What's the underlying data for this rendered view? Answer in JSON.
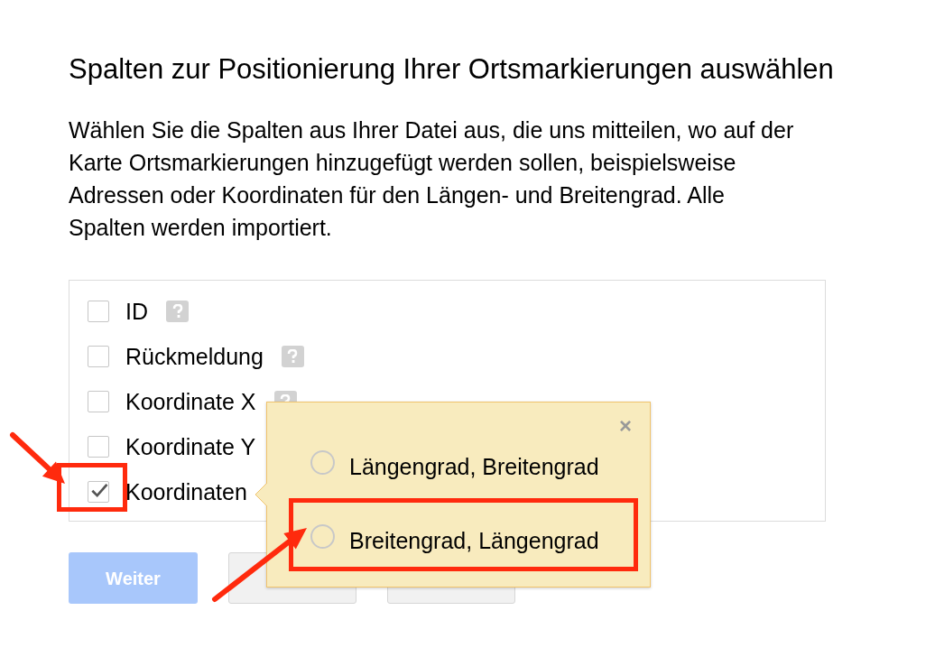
{
  "title": "Spalten zur Positionierung Ihrer Ortsmarkierungen auswählen",
  "description": "Wählen Sie die Spalten aus Ihrer Datei aus, die uns mitteilen, wo auf der Karte Ortsmarkierungen hinzugefügt werden sollen, beispielsweise Adressen oder Koordinaten für den Längen- und Breitengrad. Alle Spalten werden importiert.",
  "columns": [
    {
      "label": "ID",
      "checked": false,
      "help": true,
      "highlight": false
    },
    {
      "label": "Rückmeldung",
      "checked": false,
      "help": true,
      "highlight": false
    },
    {
      "label": "Koordinate X",
      "checked": false,
      "help": true,
      "highlight": false
    },
    {
      "label": "Koordinate Y",
      "checked": false,
      "highlight": false
    },
    {
      "label": "Koordinaten",
      "checked": true,
      "highlight": true
    }
  ],
  "popup": {
    "close": "×",
    "options": [
      {
        "label": "Längengrad, Breitengrad",
        "selected": false,
        "highlight": false
      },
      {
        "label": "Breitengrad, Längengrad",
        "selected": false,
        "highlight": true
      }
    ]
  },
  "buttons": [
    {
      "label": "Weiter",
      "kind": "primary",
      "disabled": true
    },
    {
      "kind": "secondary"
    },
    {
      "kind": "secondary"
    }
  ]
}
